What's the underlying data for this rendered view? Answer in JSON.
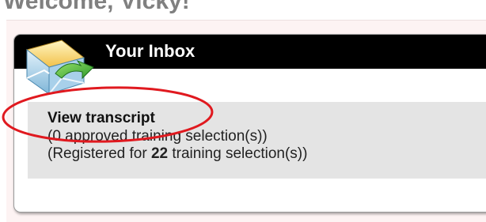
{
  "page": {
    "welcome": "Welcome, Vicky!"
  },
  "inbox": {
    "title": "Your Inbox",
    "icon": "inbox-envelope-icon",
    "view_transcript": "View transcript",
    "approved_prefix": "(",
    "approved_count": "0",
    "approved_suffix": " approved training selection(s))",
    "registered_prefix": "(Registered for ",
    "registered_count": "22",
    "registered_suffix": " training selection(s))"
  },
  "colors": {
    "header_bg": "#000000",
    "header_text": "#ffffff",
    "content_bg": "#e4e4e4",
    "annotation": "#e0191f",
    "page_tint": "#fdf3f3"
  }
}
